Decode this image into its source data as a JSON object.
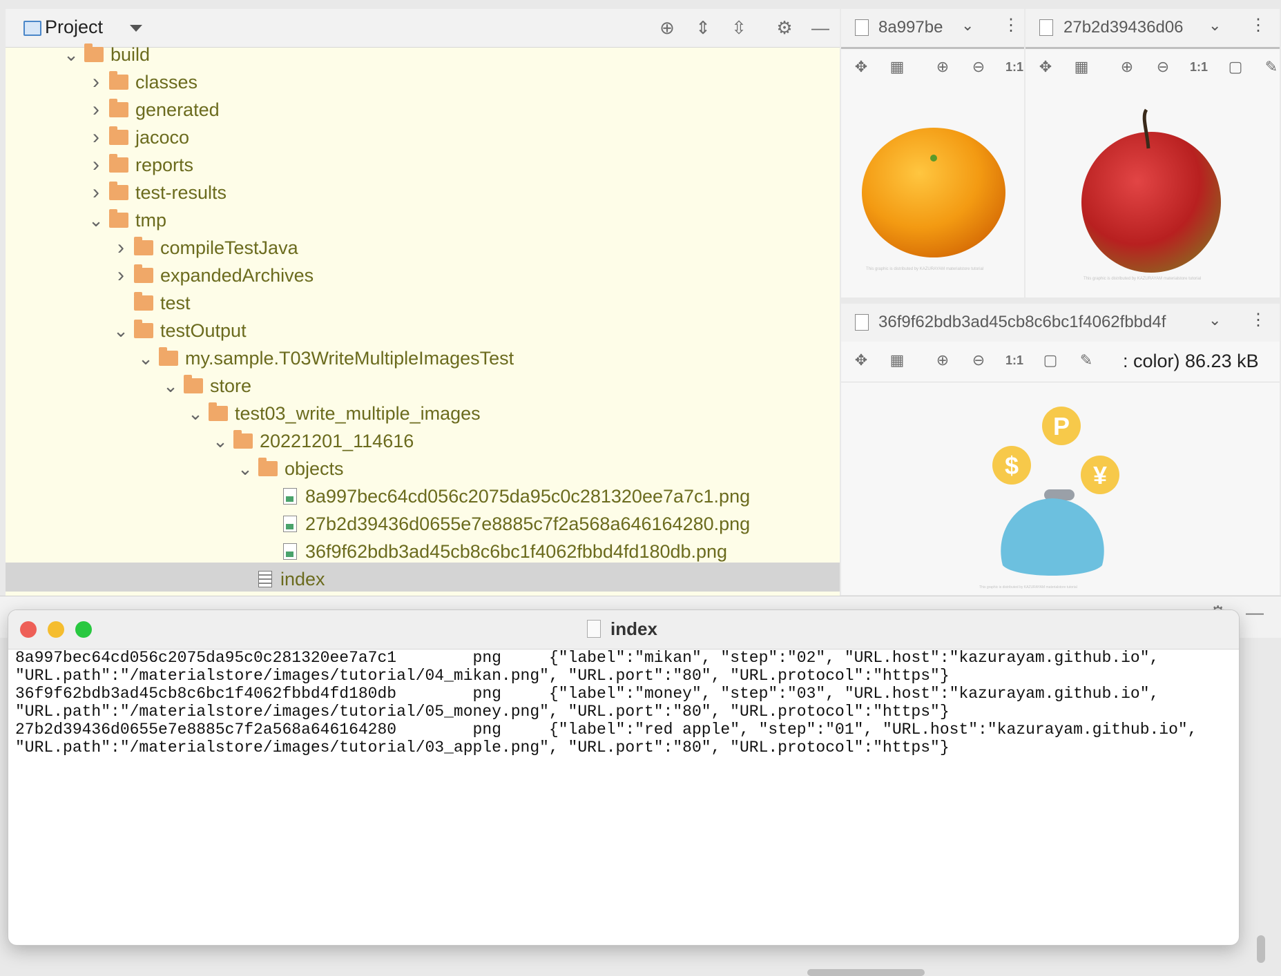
{
  "project_panel": {
    "title": "Project",
    "tree": [
      {
        "label": "build",
        "type": "folder",
        "expanded": true,
        "depth": 0
      },
      {
        "label": "classes",
        "type": "folder",
        "expanded": false,
        "depth": 1
      },
      {
        "label": "generated",
        "type": "folder",
        "expanded": false,
        "depth": 1
      },
      {
        "label": "jacoco",
        "type": "folder",
        "expanded": false,
        "depth": 1
      },
      {
        "label": "reports",
        "type": "folder",
        "expanded": false,
        "depth": 1
      },
      {
        "label": "test-results",
        "type": "folder",
        "expanded": false,
        "depth": 1
      },
      {
        "label": "tmp",
        "type": "folder",
        "expanded": true,
        "depth": 1
      },
      {
        "label": "compileTestJava",
        "type": "folder",
        "expanded": false,
        "depth": 2
      },
      {
        "label": "expandedArchives",
        "type": "folder",
        "expanded": false,
        "depth": 2
      },
      {
        "label": "test",
        "type": "folder",
        "expanded": null,
        "depth": 2
      },
      {
        "label": "testOutput",
        "type": "folder",
        "expanded": true,
        "depth": 2
      },
      {
        "label": "my.sample.T03WriteMultipleImagesTest",
        "type": "folder",
        "expanded": true,
        "depth": 3
      },
      {
        "label": "store",
        "type": "folder",
        "expanded": true,
        "depth": 4
      },
      {
        "label": "test03_write_multiple_images",
        "type": "folder",
        "expanded": true,
        "depth": 5
      },
      {
        "label": "20221201_114616",
        "type": "folder",
        "expanded": true,
        "depth": 6
      },
      {
        "label": "objects",
        "type": "folder",
        "expanded": true,
        "depth": 7
      },
      {
        "label": "8a997bec64cd056c2075da95c0c281320ee7a7c1.png",
        "type": "image",
        "depth": 8
      },
      {
        "label": "27b2d39436d0655e7e8885c7f2a568a646164280.png",
        "type": "image",
        "depth": 8
      },
      {
        "label": "36f9f62bdb3ad45cb8c6bc1f4062fbbd4fd180db.png",
        "type": "image",
        "depth": 8
      },
      {
        "label": "index",
        "type": "text",
        "depth": 7,
        "selected": true
      }
    ]
  },
  "image_editors": {
    "tab1": "8a997be",
    "tab2": "27b2d39436d06",
    "tab3": "36f9f62bdb3ad45cb8c6bc1f4062fbbd4f",
    "zoom_1to1": "1:1",
    "image3_info": ": color) 86.23 kB",
    "coin_p": "P",
    "coin_dollar": "$",
    "coin_yen": "¥"
  },
  "index_window": {
    "title": "index",
    "lines": [
      {
        "id": "8a997bec64cd056c2075da95c0c281320ee7a7c1",
        "type": "png",
        "meta1": "{\"label\":\"mikan\", \"step\":\"02\", \"URL.host\":\"kazurayam.github.io\",",
        "meta2": "\"URL.path\":\"/materialstore/images/tutorial/04_mikan.png\", \"URL.port\":\"80\", \"URL.protocol\":\"https\"}"
      },
      {
        "id": "36f9f62bdb3ad45cb8c6bc1f4062fbbd4fd180db",
        "type": "png",
        "meta1": "{\"label\":\"money\", \"step\":\"03\", \"URL.host\":\"kazurayam.github.io\",",
        "meta2": "\"URL.path\":\"/materialstore/images/tutorial/05_money.png\", \"URL.port\":\"80\", \"URL.protocol\":\"https\"}"
      },
      {
        "id": "27b2d39436d0655e7e8885c7f2a568a646164280",
        "type": "png",
        "meta1": "{\"label\":\"red apple\", \"step\":\"01\", \"URL.host\":\"kazurayam.github.io\",",
        "meta2": "\"URL.path\":\"/materialstore/images/tutorial/03_apple.png\", \"URL.port\":\"80\", \"URL.protocol\":\"https\"}"
      }
    ]
  },
  "colors": {
    "tree_text": "#6b6b1e",
    "folder": "#f0a868",
    "tree_bg": "#fefde8",
    "close": "#ee5f57",
    "minimize": "#f5bd2f",
    "zoom": "#29c840"
  }
}
